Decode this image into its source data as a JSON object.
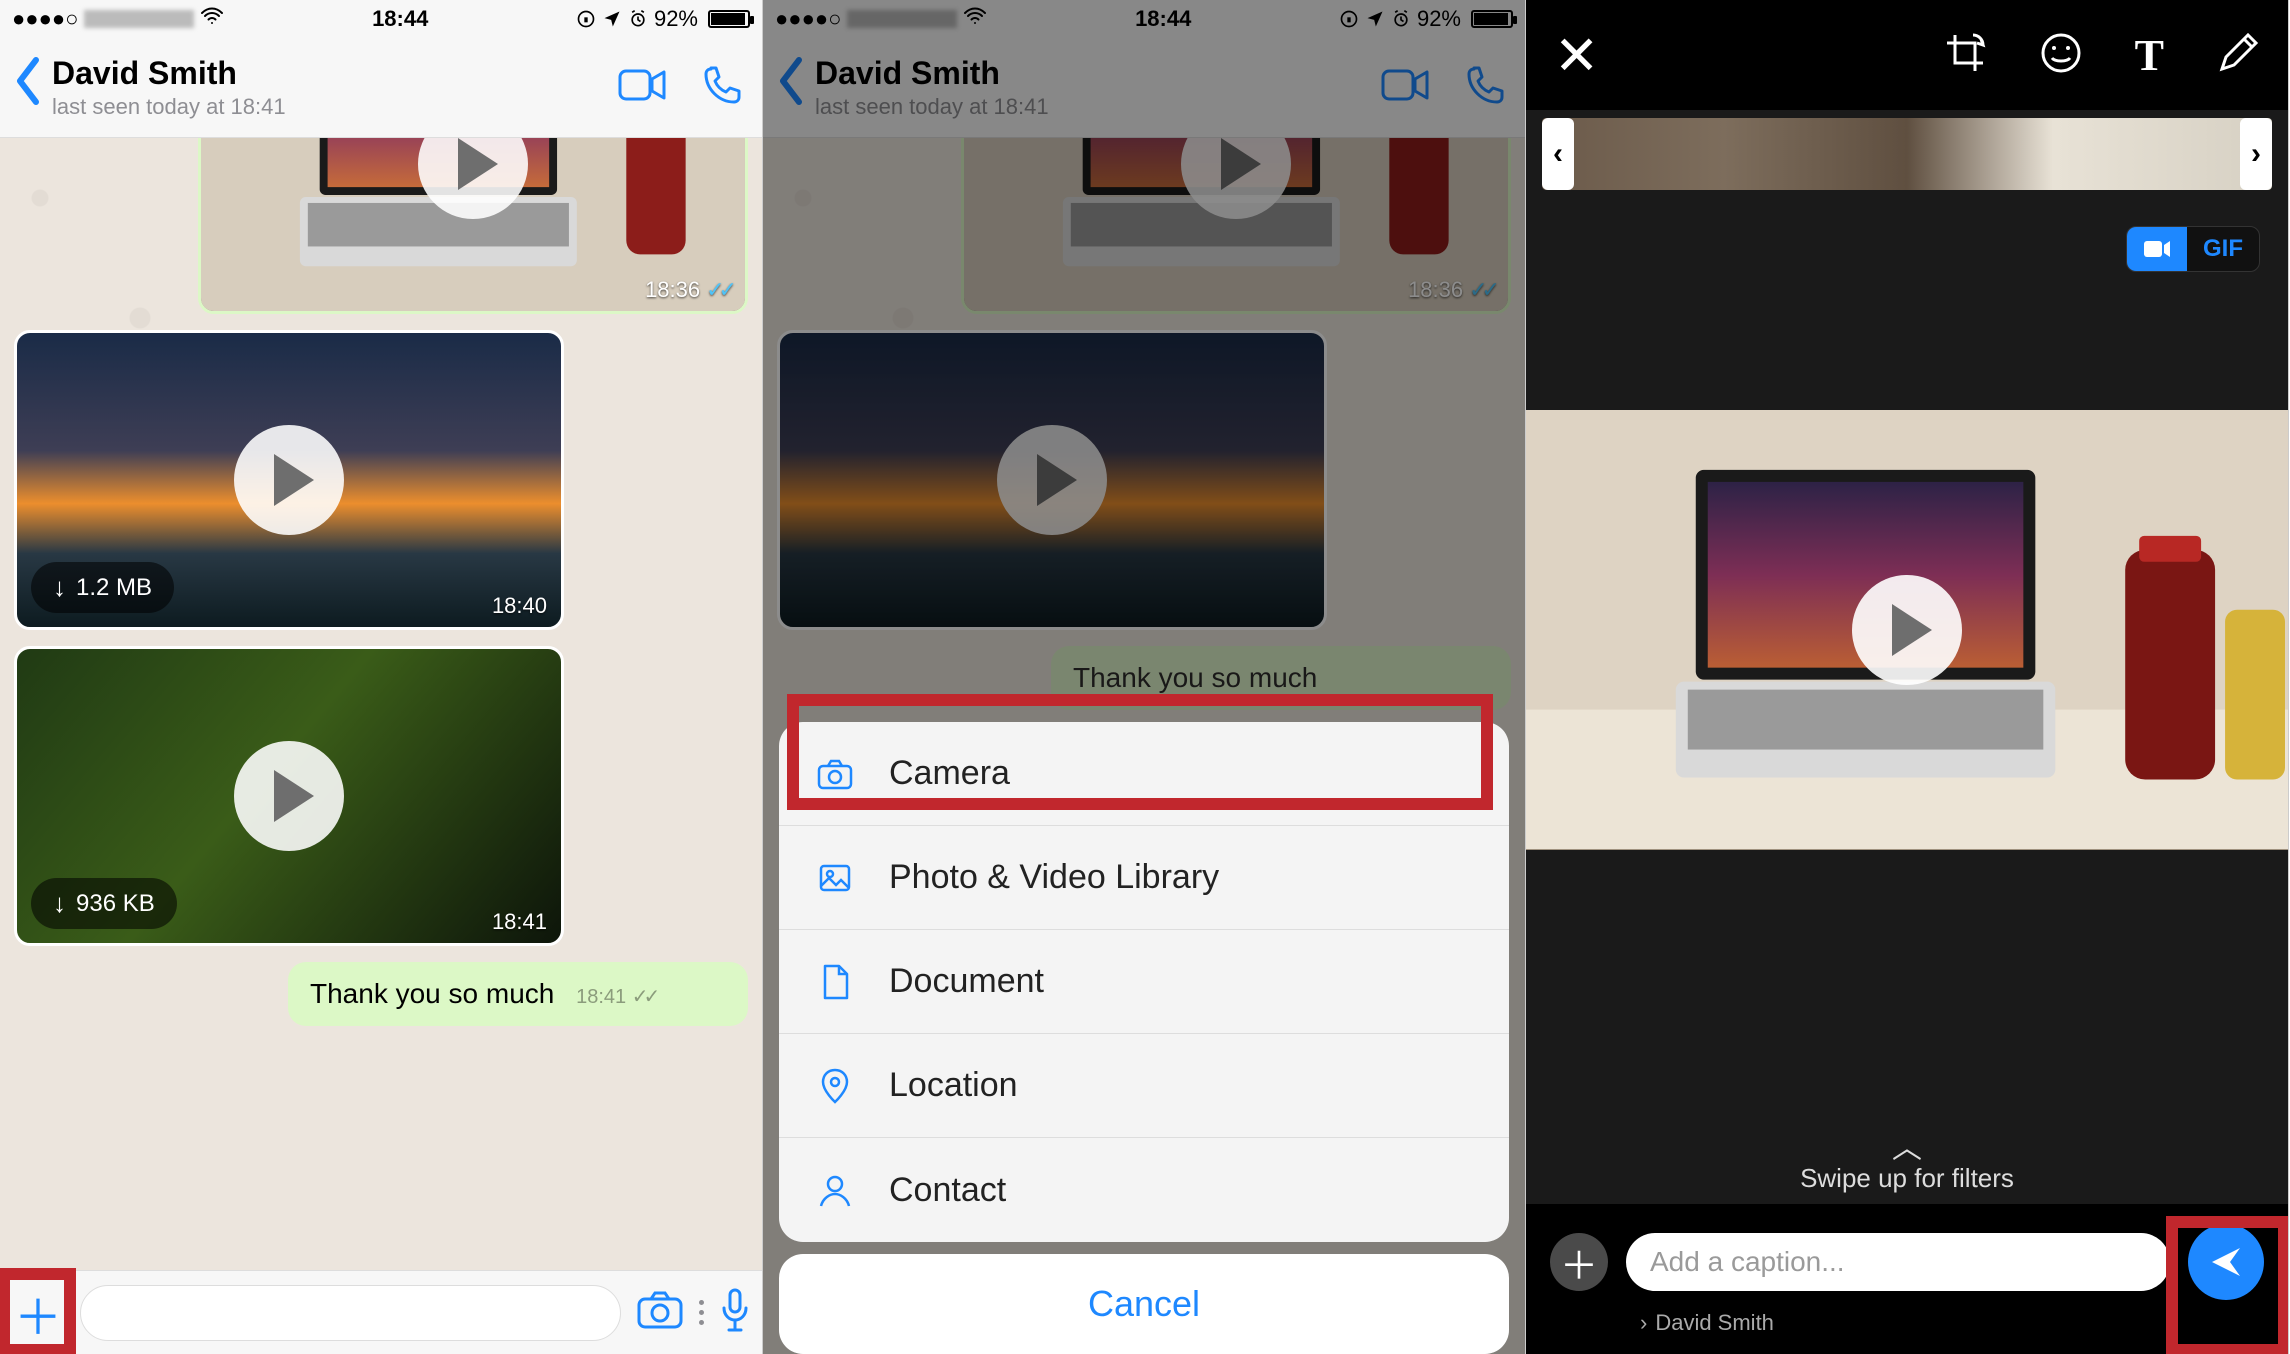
{
  "statusbar": {
    "dots": "●●●●○",
    "time": "18:44",
    "batteryPct": "92%"
  },
  "chat": {
    "name": "David Smith",
    "lastSeen": "last seen today at 18:41",
    "messages": {
      "outVideoTime": "18:36",
      "inVideo1Size": "1.2 MB",
      "inVideo1Time": "18:40",
      "inVideo2Size": "936 KB",
      "inVideo2Time": "18:41",
      "textMsg": "Thank you so much",
      "textTime": "18:41"
    }
  },
  "actionSheet": {
    "items": {
      "camera": "Camera",
      "library": "Photo & Video Library",
      "document": "Document",
      "location": "Location",
      "contact": "Contact"
    },
    "cancel": "Cancel"
  },
  "editor": {
    "gifLabel": "GIF",
    "swipeHint": "Swipe up for filters",
    "captionPlaceholder": "Add a caption...",
    "recipient": "David Smith"
  }
}
